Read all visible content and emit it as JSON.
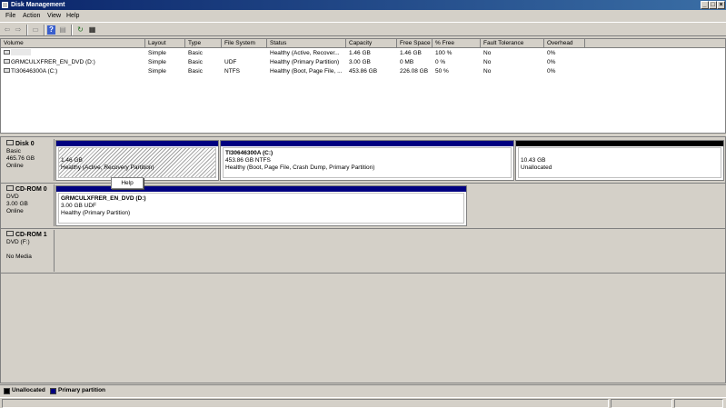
{
  "window": {
    "title": "Disk Management"
  },
  "menu": {
    "items": [
      "File",
      "Action",
      "View",
      "Help"
    ]
  },
  "toolbar": {
    "buttons": [
      {
        "name": "back",
        "glyph": "⇦"
      },
      {
        "name": "forward",
        "glyph": "⇨"
      },
      {
        "name": "show-hide-console-tree",
        "glyph": "▭"
      },
      {
        "name": "help",
        "glyph": "?"
      },
      {
        "name": "properties",
        "glyph": "▤"
      },
      {
        "name": "refresh",
        "glyph": "↻"
      },
      {
        "name": "export",
        "glyph": "▦"
      }
    ]
  },
  "volumes": {
    "columns": [
      "Volume",
      "Layout",
      "Type",
      "File System",
      "Status",
      "Capacity",
      "Free Space",
      "% Free",
      "Fault Tolerance",
      "Overhead"
    ],
    "rows": [
      [
        "",
        "Simple",
        "Basic",
        "",
        "Healthy (Active, Recover...",
        "1.46 GB",
        "1.46 GB",
        "100 %",
        "No",
        "0%"
      ],
      [
        "GRMCULXFRER_EN_DVD (D:)",
        "Simple",
        "Basic",
        "UDF",
        "Healthy (Primary Partition)",
        "3.00 GB",
        "0 MB",
        "0 %",
        "No",
        "0%"
      ],
      [
        "TI30646300A (C:)",
        "Simple",
        "Basic",
        "NTFS",
        "Healthy (Boot, Page File, ...",
        "453.86 GB",
        "226.08 GB",
        "50 %",
        "No",
        "0%"
      ]
    ]
  },
  "disks": [
    {
      "name": "Disk 0",
      "lines": [
        "Basic",
        "465.76 GB",
        "Online"
      ],
      "partitions": [
        {
          "title": "",
          "size": "1.46 GB",
          "status": "Healthy (Active, Recovery Partition)"
        },
        {
          "title": "TI30646300A  (C:)",
          "size": "453.86 GB NTFS",
          "status": "Healthy (Boot, Page File, Crash Dump, Primary Partition)"
        },
        {
          "title": "",
          "size": "10.43 GB",
          "status": "Unallocated"
        }
      ]
    },
    {
      "name": "CD-ROM 0",
      "lines": [
        "DVD",
        "3.00 GB",
        "Online"
      ],
      "partitions": [
        {
          "title": "GRMCULXFRER_EN_DVD  (D:)",
          "size": "3.00 GB UDF",
          "status": "Healthy (Primary Partition)"
        }
      ]
    },
    {
      "name": "CD-ROM 1",
      "lines": [
        "DVD (F:)",
        "",
        "No Media"
      ],
      "partitions": []
    }
  ],
  "context_menu": {
    "item": "Help"
  },
  "legend": [
    {
      "label": "Unallocated",
      "color": "#000000"
    },
    {
      "label": "Primary partition",
      "color": "#000080"
    }
  ],
  "colors": {
    "primary": "#000080",
    "unallocated": "#000000",
    "titlebar": "#0a246a"
  }
}
